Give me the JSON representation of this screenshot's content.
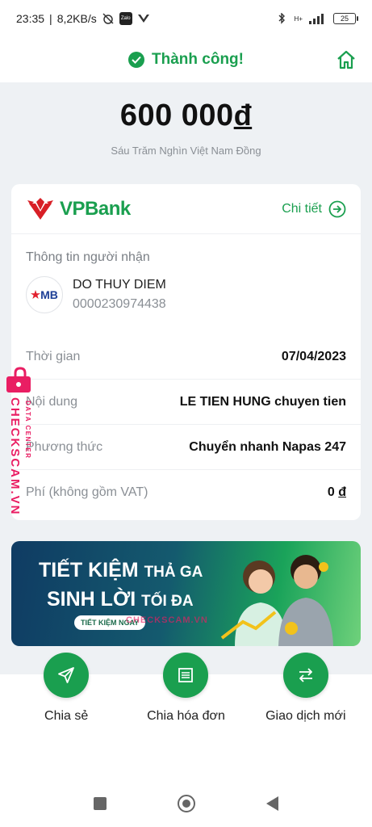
{
  "status_bar": {
    "time": "23:35",
    "speed": "8,2KB/s",
    "app_icon_text": "Zalo",
    "network": "H+",
    "battery": "25"
  },
  "header": {
    "title": "Thành công!"
  },
  "amount": {
    "value": "600 000",
    "currency": "đ",
    "words": "Sáu Trăm Nghìn Việt Nam Đồng"
  },
  "bank": {
    "name": "VPBank",
    "detail_link": "Chi tiết"
  },
  "recipient": {
    "section_title": "Thông tin người nhận",
    "bank_logo": "MB",
    "name": "DO THUY DIEM",
    "account": "0000230974438"
  },
  "details": {
    "time_label": "Thời gian",
    "time_value": "07/04/2023",
    "content_label": "Nội dung",
    "content_value": "LE TIEN HUNG chuyen tien",
    "method_label": "Phương thức",
    "method_value": "Chuyển nhanh Napas 247",
    "fee_label": "Phí (không gồm VAT)",
    "fee_value": "0",
    "fee_currency": "đ"
  },
  "banner": {
    "line1_big": "TIẾT KIỆM",
    "line1_small": "THẢ GA",
    "line2_big": "SINH LỜI",
    "line2_small": "TỐI ĐA",
    "button": "TIẾT KIỆM NGAY",
    "watermark": "CHECKSCAM.VN"
  },
  "watermark": {
    "main": "CHECKSCAM.VN",
    "sub": "DATA CENTER"
  },
  "actions": [
    {
      "label": "Chia sẻ"
    },
    {
      "label": "Chia hóa đơn"
    },
    {
      "label": "Giao dịch mới"
    }
  ],
  "colors": {
    "primary": "#1a9f4f",
    "background": "#eef1f4",
    "watermark": "#e91e63",
    "vpbank_red": "#d81f26"
  }
}
